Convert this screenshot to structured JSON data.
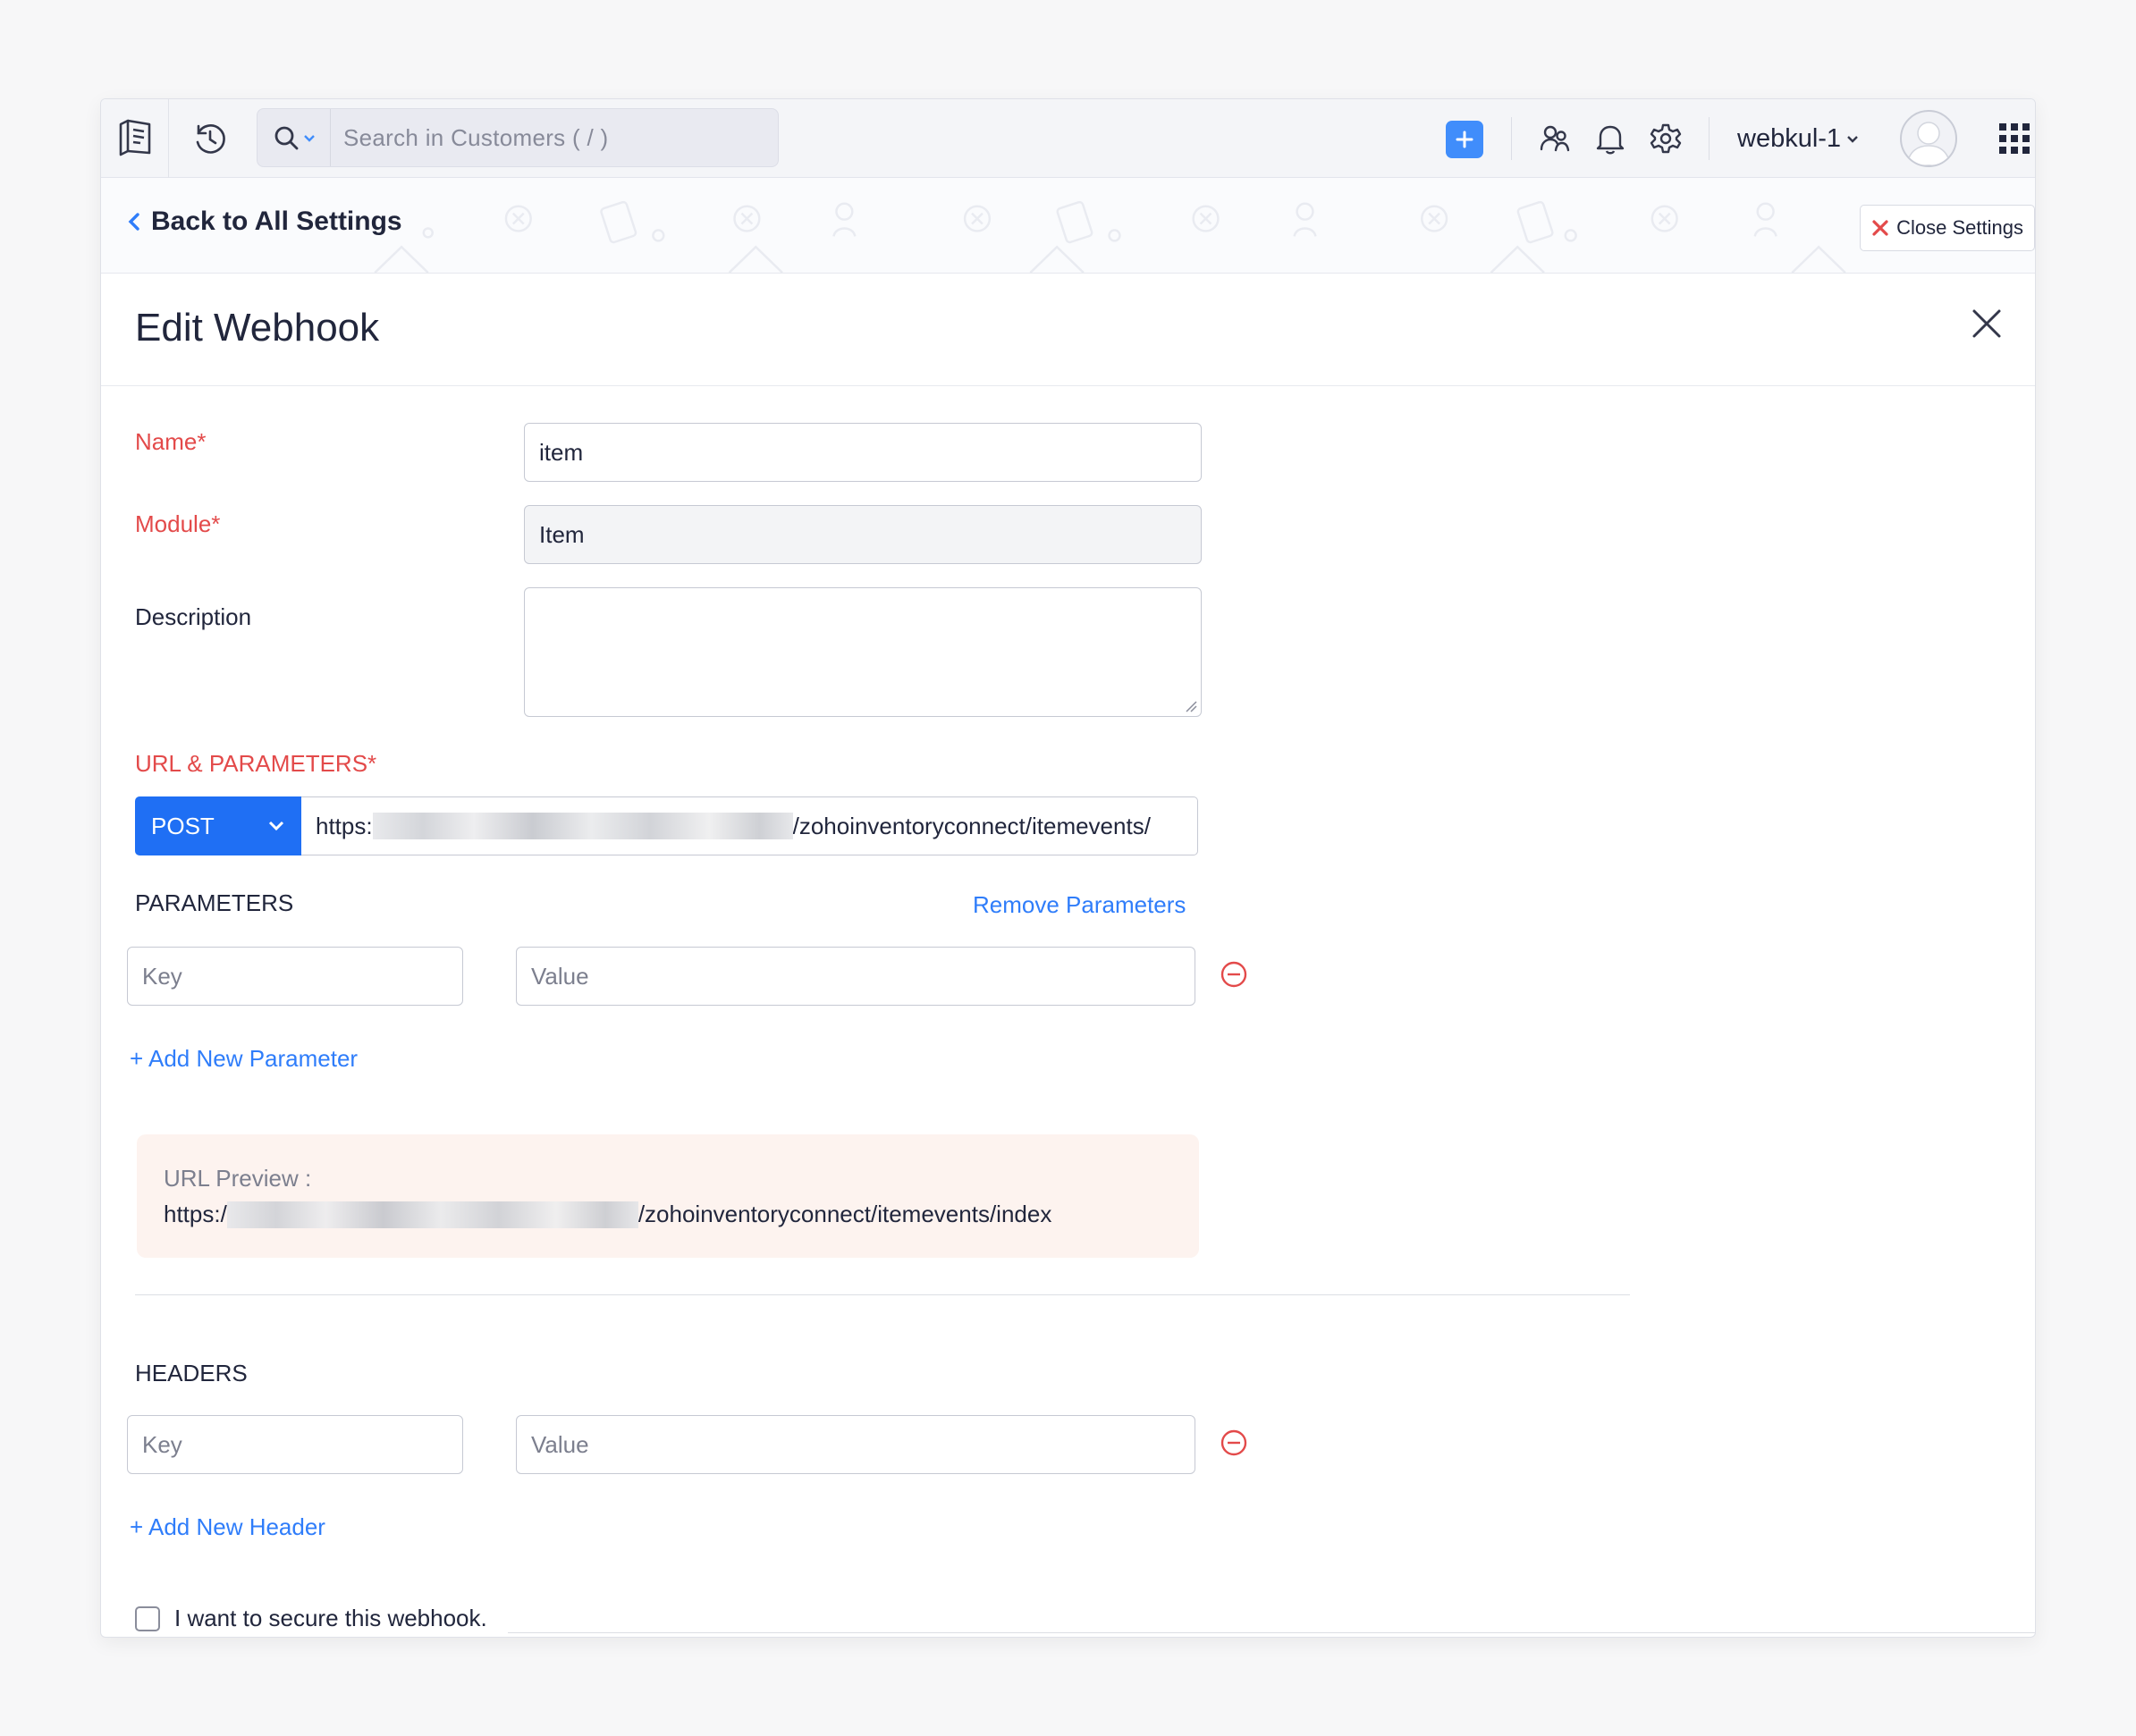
{
  "topbar": {
    "search_placeholder": "Search in Customers ( / )",
    "org_name": "webkul-1",
    "icons": [
      "app-logo-icon",
      "history-icon",
      "search-icon",
      "chevron-down-icon",
      "plus-icon",
      "contacts-icon",
      "bell-icon",
      "gear-icon",
      "apps-grid-icon"
    ]
  },
  "settings": {
    "back_label": "Back to All Settings",
    "close_label": "Close Settings"
  },
  "edit": {
    "title": "Edit Webhook"
  },
  "form": {
    "name_label": "Name*",
    "name_value": "item",
    "module_label": "Module*",
    "module_value": "Item",
    "description_label": "Description",
    "description_value": "",
    "url_section_label": "URL & PARAMETERS*",
    "method": "POST",
    "url_prefix": "https:",
    "url_suffix": "/zohoinventoryconnect/itemevents/",
    "parameters_label": "PARAMETERS",
    "remove_parameters": "Remove Parameters",
    "param_key_placeholder": "Key",
    "param_value_placeholder": "Value",
    "add_parameter": "+ Add New Parameter",
    "url_preview_label": "URL Preview :",
    "url_preview_prefix": "https:/",
    "url_preview_suffix": "/zohoinventoryconnect/itemevents/index",
    "headers_label": "HEADERS",
    "header_key_placeholder": "Key",
    "header_value_placeholder": "Value",
    "add_header": "+ Add New Header",
    "secure_label": "I want to secure this webhook."
  },
  "colors": {
    "accent": "#408dfb",
    "method_bg": "#1f6ff4",
    "required": "#e34a4a",
    "link": "#2f7dfa",
    "preview_bg": "#fdf3ef"
  }
}
